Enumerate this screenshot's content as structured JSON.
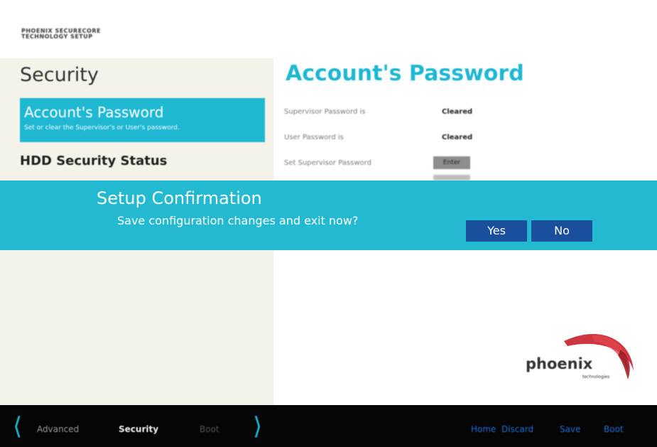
{
  "brand": {
    "line1": "PHOENIX SECURECORE",
    "line2": "TECHNOLOGY SETUP"
  },
  "left": {
    "section_title": "Security",
    "active_item": {
      "label": "Account's Password",
      "description": "Set or clear the Supervisor's or User's password."
    },
    "item": "HDD Security Status"
  },
  "main": {
    "title": "Account's Password",
    "rows": [
      {
        "label": "Supervisor Password is",
        "value": "Cleared"
      },
      {
        "label": "User Password is",
        "value": "Cleared"
      },
      {
        "label": "Set Supervisor Password",
        "button": "Enter"
      }
    ]
  },
  "dialog": {
    "title": "Setup Confirmation",
    "message": "Save configuration changes and exit now?",
    "yes": "Yes",
    "no": "No"
  },
  "logo": {
    "word": "phoenix",
    "sub": "technologies"
  },
  "bottom": {
    "tabs": [
      "Advanced",
      "Security",
      "Boot"
    ],
    "actions": [
      "Home",
      "Discard",
      "Save",
      "Boot"
    ]
  },
  "colors": {
    "accent": "#1fb8d3",
    "dialog_bg": "#23b9d1",
    "button": "#1a4f9e",
    "bar": "#050505",
    "link": "#1a6fd6"
  }
}
